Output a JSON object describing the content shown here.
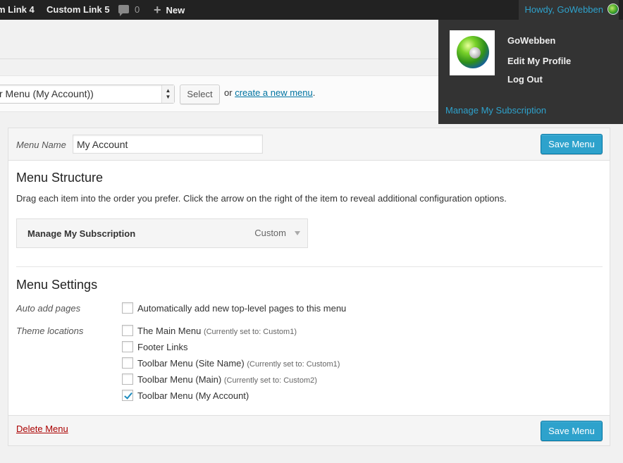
{
  "admin_bar": {
    "custom_link_4": "m Link 4",
    "custom_link_5": "Custom Link 5",
    "comments_icon": "comment-bubble-icon",
    "comments_count": "0",
    "new_icon": "plus-icon",
    "new_label": "New",
    "howdy": "Howdy, GoWebben"
  },
  "account_menu": {
    "display_name": "GoWebben",
    "edit_profile": "Edit My Profile",
    "log_out": "Log Out",
    "subscription_link": "Manage My Subscription"
  },
  "manage_menus": {
    "selected_menu": "r Menu (My Account))",
    "select_button": "Select",
    "or_text": "or",
    "create_link": "create a new menu",
    "period": "."
  },
  "menu_editor": {
    "menu_name_label": "Menu Name",
    "menu_name_value": "My Account",
    "save_label": "Save Menu",
    "structure_title": "Menu Structure",
    "structure_description": "Drag each item into the order you prefer. Click the arrow on the right of the item to reveal additional configuration options.",
    "items": [
      {
        "title": "Manage My Subscription",
        "type": "Custom"
      }
    ],
    "settings_title": "Menu Settings",
    "auto_add_label": "Auto add pages",
    "auto_add_option": "Automatically add new top-level pages to this menu",
    "theme_locations_label": "Theme locations",
    "locations": [
      {
        "label": "The Main Menu",
        "note": "(Currently set to: Custom1)",
        "checked": false
      },
      {
        "label": "Footer Links",
        "note": "",
        "checked": false
      },
      {
        "label": "Toolbar Menu (Site Name)",
        "note": "(Currently set to: Custom1)",
        "checked": false
      },
      {
        "label": "Toolbar Menu (Main)",
        "note": "(Currently set to: Custom2)",
        "checked": false
      },
      {
        "label": "Toolbar Menu (My Account)",
        "note": "",
        "checked": true
      }
    ],
    "delete_label": "Delete Menu"
  },
  "colors": {
    "admin_bar_bg": "#222222",
    "accent_blue": "#2ea2cc",
    "delete_red": "#aa0000"
  }
}
